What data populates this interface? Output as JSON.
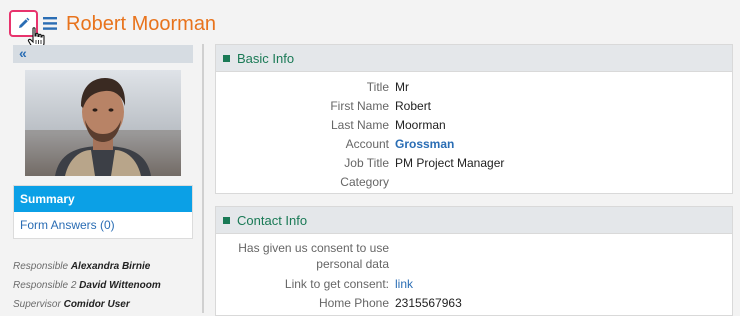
{
  "header": {
    "title": "Robert Moorman"
  },
  "left": {
    "collapse_glyph": "«",
    "nav": [
      {
        "label": "Summary"
      },
      {
        "label": "Form Answers (0)"
      }
    ],
    "people": [
      {
        "label": "Responsible",
        "value": "Alexandra Birnie"
      },
      {
        "label": "Responsible 2",
        "value": "David Wittenoom"
      },
      {
        "label": "Supervisor",
        "value": "Comidor User"
      }
    ]
  },
  "basic_info": {
    "heading": "Basic Info",
    "rows": [
      {
        "key": "Title",
        "value": "Mr"
      },
      {
        "key": "First Name",
        "value": "Robert"
      },
      {
        "key": "Last Name",
        "value": "Moorman"
      },
      {
        "key": "Account",
        "value": "Grossman"
      },
      {
        "key": "Job Title",
        "value": "PM Project Manager"
      },
      {
        "key": "Category",
        "value": ""
      }
    ]
  },
  "contact_info": {
    "heading": "Contact Info",
    "consent_label_1": "Has given us consent to use",
    "consent_label_2": "personal data",
    "link_label": "Link to get consent:",
    "link_value": "link",
    "phone_label": "Home Phone",
    "phone_value": "2315567963"
  },
  "icons": {
    "edit": "pencil-icon",
    "menu": "hamburger-menu-icon",
    "cursor": "hand-pointer-cursor-icon",
    "section": "green-square-icon"
  },
  "colors": {
    "title": "#e8731c",
    "accent": "#0ba0e6",
    "link": "#2a6db4",
    "section_heading": "#1a7a56",
    "edit_highlight": "#e8336d"
  }
}
